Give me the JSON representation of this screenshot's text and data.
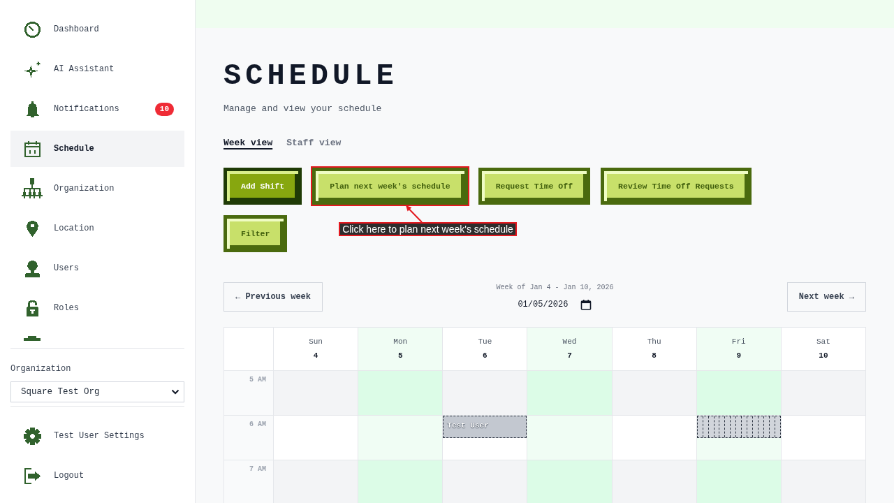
{
  "sidebar": {
    "nav": [
      {
        "label": "Dashboard",
        "selected": false
      },
      {
        "label": "AI Assistant",
        "selected": false
      },
      {
        "label": "Notifications",
        "selected": false,
        "badge": "10"
      },
      {
        "label": "Schedule",
        "selected": true
      },
      {
        "label": "Organization",
        "selected": false
      },
      {
        "label": "Location",
        "selected": false
      },
      {
        "label": "Users",
        "selected": false
      },
      {
        "label": "Roles",
        "selected": false
      }
    ],
    "organization": {
      "label": "Organization",
      "value": "Square Test Org"
    },
    "account": [
      {
        "label": "Test User Settings"
      },
      {
        "label": "Logout"
      }
    ]
  },
  "header": {
    "title": "SCHEDULE",
    "subtitle": "Manage and view your schedule"
  },
  "view_tabs": [
    {
      "label": "Week view",
      "selected": true
    },
    {
      "label": "Staff view",
      "selected": false
    }
  ],
  "actions": [
    {
      "label": "Add Shift",
      "kind": "primary",
      "highlighted": false
    },
    {
      "label": "Plan next week's schedule",
      "kind": "secondary",
      "highlighted": true
    },
    {
      "label": "Request Time Off",
      "kind": "secondary",
      "highlighted": false
    },
    {
      "label": "Review Time Off Requests",
      "kind": "secondary",
      "highlighted": false
    },
    {
      "label": "Filter",
      "kind": "secondary",
      "highlighted": false
    }
  ],
  "annotation": {
    "text": "Click here to plan next week's schedule"
  },
  "week_nav": {
    "previous": "← Previous week",
    "range": "Week of Jan 4 - Jan 10, 2026",
    "date": "01/05/2026",
    "next": "Next week →"
  },
  "calendar": {
    "days": [
      {
        "name": "Sun",
        "date": "4"
      },
      {
        "name": "Mon",
        "date": "5"
      },
      {
        "name": "Tue",
        "date": "6"
      },
      {
        "name": "Wed",
        "date": "7"
      },
      {
        "name": "Thu",
        "date": "8"
      },
      {
        "name": "Fri",
        "date": "9"
      },
      {
        "name": "Sat",
        "date": "10"
      }
    ],
    "rows": [
      {
        "time": "5 AM"
      },
      {
        "time": "6 AM",
        "cells": [
          {
            "kind": "empty"
          },
          {
            "kind": "empty"
          },
          {
            "kind": "shift",
            "label": "Test User"
          },
          {
            "kind": "empty"
          },
          {
            "kind": "empty"
          },
          {
            "kind": "stacked"
          },
          {
            "kind": "empty"
          }
        ]
      },
      {
        "time": "7 AM"
      }
    ]
  }
}
